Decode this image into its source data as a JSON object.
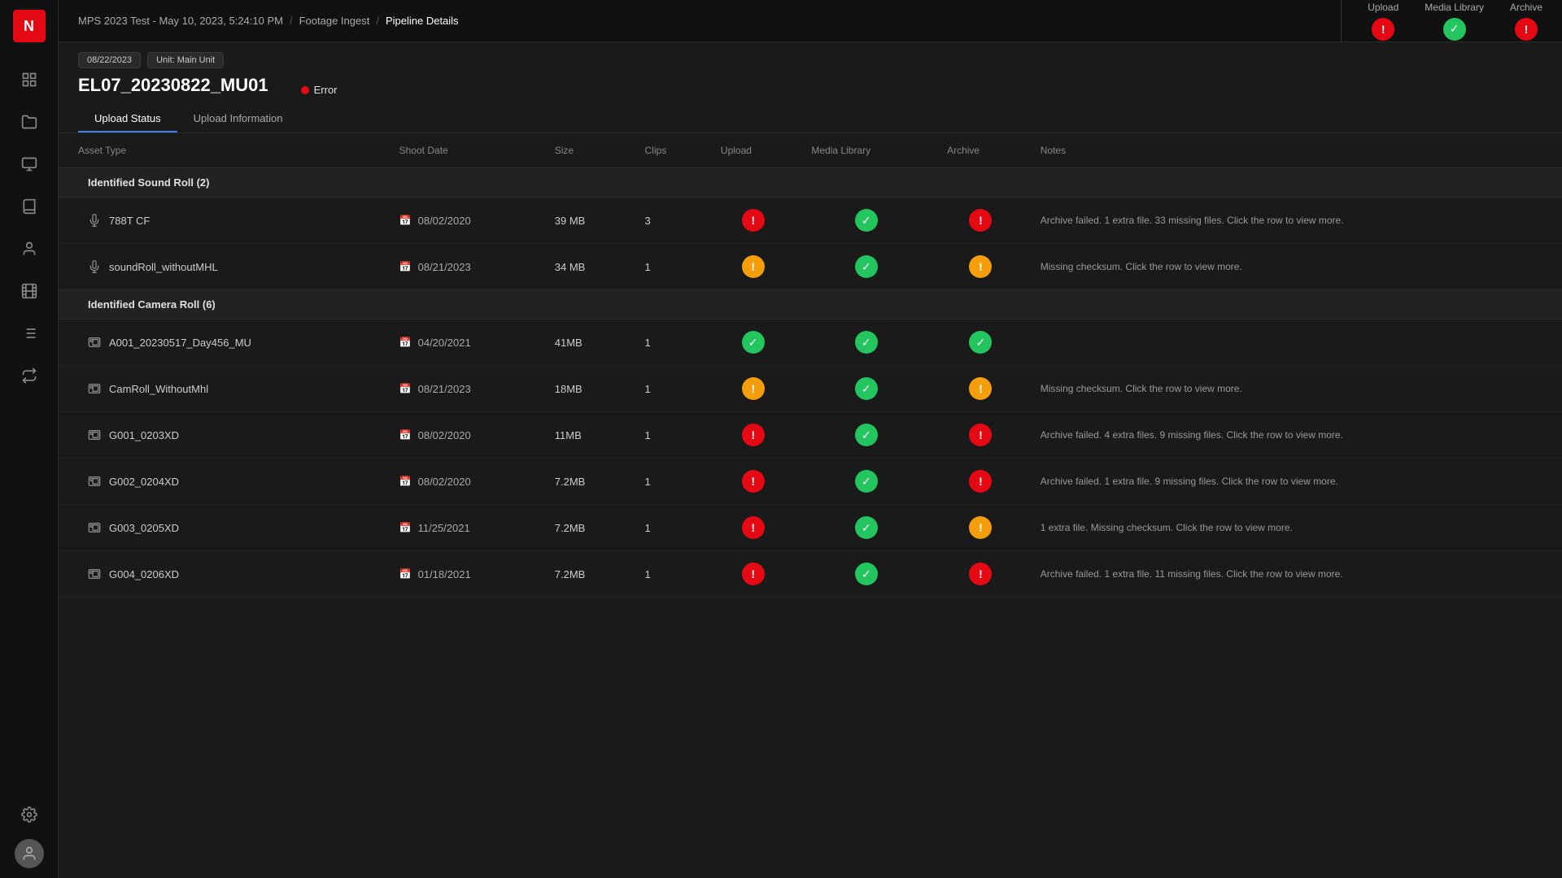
{
  "app": {
    "logo": "N"
  },
  "sidebar": {
    "nav_items": [
      {
        "name": "dashboard-icon",
        "label": "Dashboard"
      },
      {
        "name": "folder-icon",
        "label": "Folder"
      },
      {
        "name": "monitor-icon",
        "label": "Monitor"
      },
      {
        "name": "library-icon",
        "label": "Library"
      },
      {
        "name": "user-check-icon",
        "label": "User Check"
      },
      {
        "name": "film-icon",
        "label": "Film"
      },
      {
        "name": "list-icon",
        "label": "List"
      }
    ],
    "bottom_items": [
      {
        "name": "settings-icon",
        "label": "Settings"
      },
      {
        "name": "avatar",
        "label": "User Avatar"
      }
    ]
  },
  "breadcrumb": {
    "items": [
      {
        "label": "MPS 2023 Test - May 10, 2023, 5:24:10 PM",
        "link": true
      },
      {
        "label": "Footage Ingest",
        "link": true
      },
      {
        "label": "Pipeline Details",
        "link": false
      }
    ]
  },
  "pipeline_header": {
    "status_sections": [
      {
        "name": "Upload",
        "label": "Upload"
      },
      {
        "name": "Media Library",
        "label": "Media Library"
      },
      {
        "name": "Archive",
        "label": "Archive"
      }
    ],
    "status_values": {
      "upload": "error",
      "media_library": "success",
      "archive": "error"
    }
  },
  "asset": {
    "tags": [
      "08/22/2023",
      "Unit: Main Unit"
    ],
    "title": "EL07_20230822_MU01",
    "error_status": "Error"
  },
  "tabs": [
    {
      "label": "Upload Status",
      "active": true
    },
    {
      "label": "Upload Information",
      "active": false
    }
  ],
  "table": {
    "columns": [
      "Asset Type",
      "Shoot Date",
      "Size",
      "Clips",
      "Upload",
      "Media Library",
      "Archive",
      "Notes"
    ],
    "groups": [
      {
        "name": "Identified Sound Roll (2)",
        "rows": [
          {
            "icon": "microphone",
            "asset": "788T CF",
            "shoot_date": "08/02/2020",
            "size": "39 MB",
            "clips": "3",
            "upload": "error",
            "media_library": "success",
            "archive": "error",
            "notes": "Archive failed. 1 extra file. 33 missing files. Click the row to view more."
          },
          {
            "icon": "microphone",
            "asset": "soundRoll_withoutMHL",
            "shoot_date": "08/21/2023",
            "size": "34 MB",
            "clips": "1",
            "upload": "warning",
            "media_library": "success",
            "archive": "warning",
            "notes": "Missing checksum. Click the row to view more."
          }
        ]
      },
      {
        "name": "Identified Camera Roll (6)",
        "rows": [
          {
            "icon": "camera",
            "asset": "A001_20230517_Day456_MU",
            "shoot_date": "04/20/2021",
            "size": "41MB",
            "clips": "1",
            "upload": "success",
            "media_library": "success",
            "archive": "success",
            "notes": ""
          },
          {
            "icon": "camera",
            "asset": "CamRoll_WithoutMhl",
            "shoot_date": "08/21/2023",
            "size": "18MB",
            "clips": "1",
            "upload": "warning",
            "media_library": "success",
            "archive": "warning",
            "notes": "Missing checksum. Click the row to view more."
          },
          {
            "icon": "camera",
            "asset": "G001_0203XD",
            "shoot_date": "08/02/2020",
            "size": "11MB",
            "clips": "1",
            "upload": "error",
            "media_library": "success",
            "archive": "error",
            "notes": "Archive failed. 4 extra files. 9 missing files. Click the row to view more."
          },
          {
            "icon": "camera",
            "asset": "G002_0204XD",
            "shoot_date": "08/02/2020",
            "size": "7.2MB",
            "clips": "1",
            "upload": "error",
            "media_library": "success",
            "archive": "error",
            "notes": "Archive failed. 1 extra file. 9 missing files. Click the row to view more."
          },
          {
            "icon": "camera",
            "asset": "G003_0205XD",
            "shoot_date": "11/25/2021",
            "size": "7.2MB",
            "clips": "1",
            "upload": "error",
            "media_library": "success",
            "archive": "warning",
            "notes": "1 extra file. Missing checksum. Click the row to view more."
          },
          {
            "icon": "camera",
            "asset": "G004_0206XD",
            "shoot_date": "01/18/2021",
            "size": "7.2MB",
            "clips": "1",
            "upload": "error",
            "media_library": "success",
            "archive": "error",
            "notes": "Archive failed. 1 extra file. 11 missing files. Click the row to view more."
          }
        ]
      }
    ]
  },
  "colors": {
    "error": "#e50914",
    "success": "#22c55e",
    "warning": "#f59e0b",
    "accent": "#3b82f6"
  }
}
